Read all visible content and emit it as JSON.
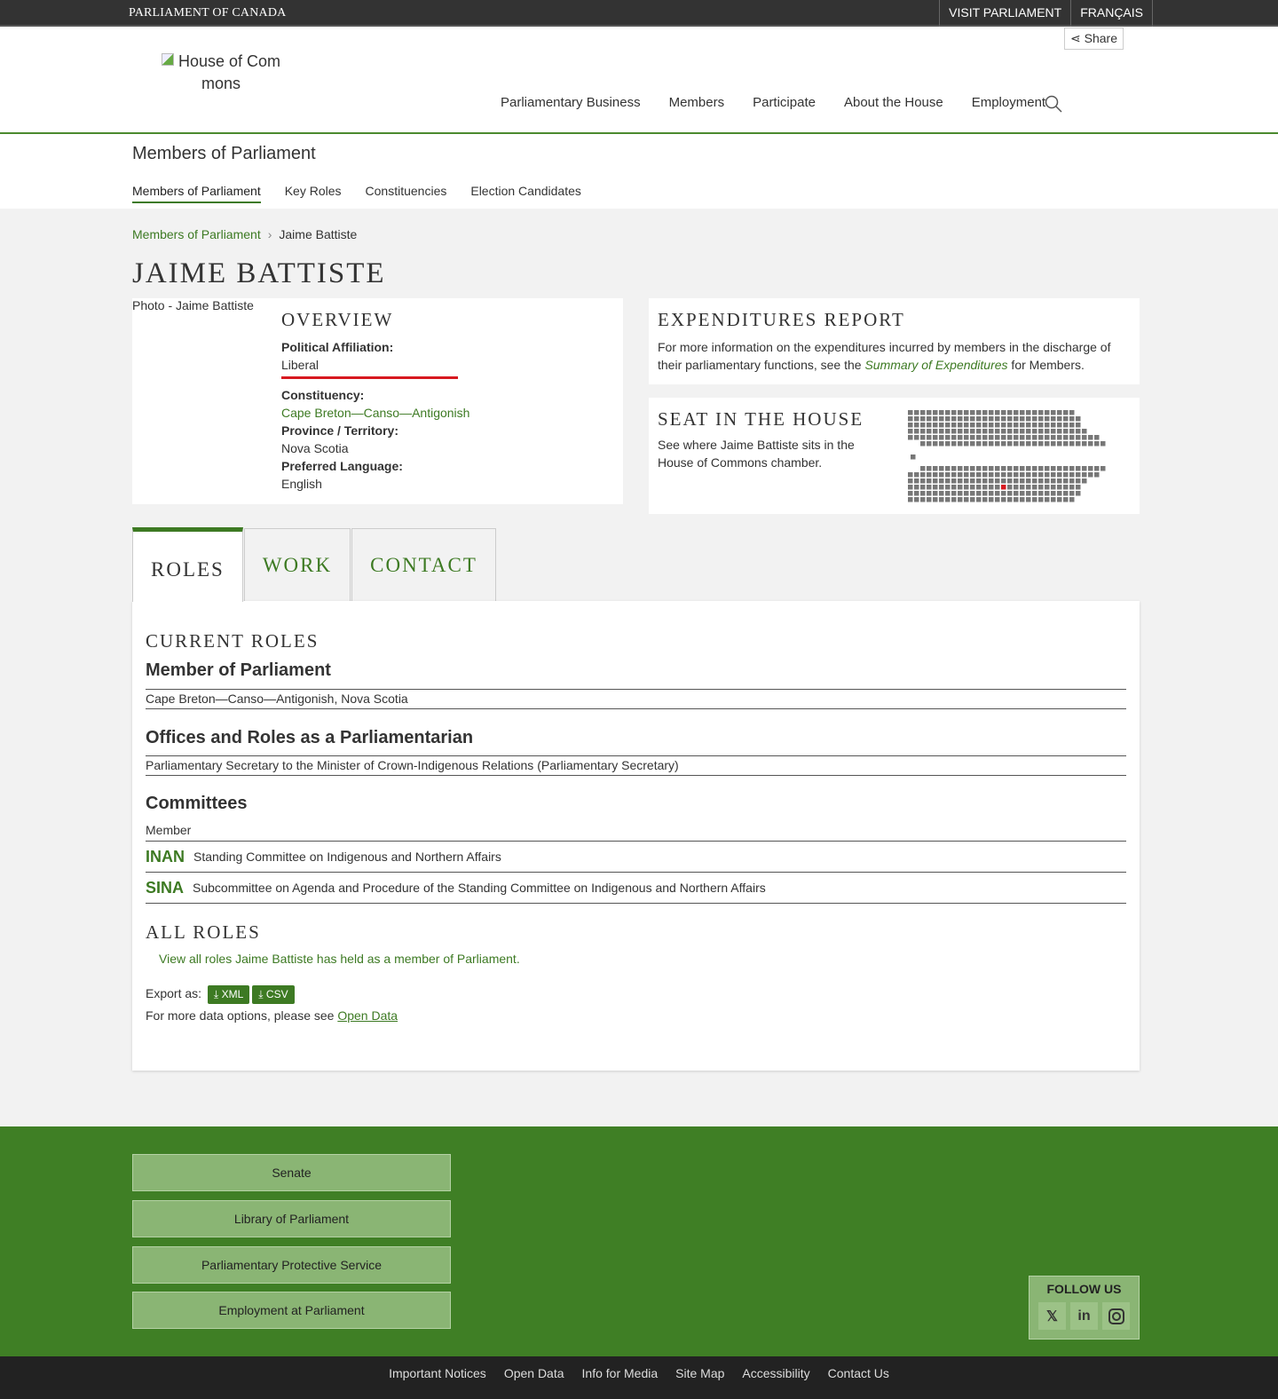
{
  "topbar": {
    "brand": "PARLIAMENT OF CANADA",
    "visit": "VISIT PARLIAMENT",
    "lang": "FRANÇAIS"
  },
  "header": {
    "share": "Share",
    "logo_alt": "House of Commons",
    "logo_line1": "House of Com",
    "logo_line2": "mons",
    "nav": [
      "Parliamentary Business",
      "Members",
      "Participate",
      "About the House",
      "Employment"
    ]
  },
  "subnav": {
    "title": "Members of Parliament",
    "tabs": [
      "Members of Parliament",
      "Key Roles",
      "Constituencies",
      "Election Candidates"
    ]
  },
  "breadcrumb": {
    "parent": "Members of Parliament",
    "current": "Jaime Battiste"
  },
  "member": {
    "name": "JAIME BATTISTE",
    "photo_alt": "Photo - Jaime Battiste"
  },
  "overview": {
    "title": "OVERVIEW",
    "affiliation_label": "Political Affiliation:",
    "affiliation": "Liberal",
    "party_color": "#d71920",
    "constituency_label": "Constituency:",
    "constituency": "Cape Breton—Canso—Antigonish",
    "province_label": "Province / Territory:",
    "province": "Nova Scotia",
    "language_label": "Preferred Language:",
    "language": "English"
  },
  "expenditures": {
    "title": "EXPENDITURES REPORT",
    "text1": "For more information on the expenditures incurred by members in the discharge of their parliamentary functions, see the ",
    "link": "Summary of Expenditures",
    "text2": " for Members."
  },
  "seat": {
    "title": "SEAT IN THE HOUSE",
    "text": "See where Jaime Battiste sits in the House of Commons chamber."
  },
  "tabs": [
    "ROLES",
    "WORK",
    "CONTACT"
  ],
  "roles": {
    "current_title": "CURRENT ROLES",
    "mp_heading": "Member of Parliament",
    "mp_row": "Cape Breton—Canso—Antigonish, Nova Scotia",
    "offices_heading": "Offices and Roles as a Parliamentarian",
    "offices_row": "Parliamentary Secretary to the Minister of Crown-Indigenous Relations (Parliamentary Secretary)",
    "committees_heading": "Committees",
    "committees_sub": "Member",
    "committees": [
      {
        "abbr": "INAN",
        "name": "Standing Committee on Indigenous and Northern Affairs"
      },
      {
        "abbr": "SINA",
        "name": "Subcommittee on Agenda and Procedure of the Standing Committee on Indigenous and Northern Affairs"
      }
    ],
    "all_title": "ALL ROLES",
    "all_link": "View all roles Jaime Battiste has held as a member of Parliament.",
    "export_label": "Export as:",
    "xml": "XML",
    "csv": "CSV",
    "more_text": "For more data options, please see ",
    "open_data": "Open Data"
  },
  "footer": {
    "links": [
      "Senate",
      "Library of Parliament",
      "Parliamentary Protective Service",
      "Employment at Parliament"
    ],
    "follow": "FOLLOW US",
    "social": [
      "X",
      "in",
      "ig"
    ],
    "bottom": [
      "Important Notices",
      "Open Data",
      "Info for Media",
      "Site Map",
      "Accessibility",
      "Contact Us"
    ]
  }
}
